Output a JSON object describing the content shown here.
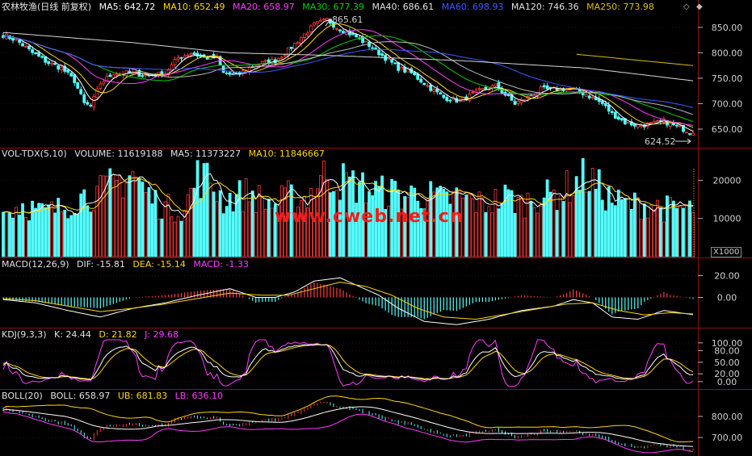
{
  "colors": {
    "up": "#ff3b3b",
    "down": "#54ffff",
    "ma5": "#ffffff",
    "ma10": "#ffd700",
    "ma20": "#ff3cff",
    "ma30": "#00d000",
    "ma60": "#3c5aff",
    "ma120": "#d8d8d8",
    "ma250": "#d8c000",
    "label": "#cccccc",
    "grid": "#8a1010"
  },
  "header": {
    "title": "农林牧渔(日线 前复权)",
    "ma5": "MA5: 642.72",
    "ma10": "MA10: 652.49",
    "ma20": "MA20: 658.97",
    "ma30": "MA30: 677.39",
    "ma40": "MA40: 686.61",
    "ma60": "MA60: 698.93",
    "ma120": "MA120: 746.36",
    "ma250": "MA250: 773.98"
  },
  "vol_header": {
    "name": "VOL-TDX(5,10)",
    "volume": "VOLUME: 11619188",
    "ma5": "MA5: 11373227",
    "ma10": "MA10: 11846667"
  },
  "macd_header": {
    "name": "MACD(12,26,9)",
    "dif": "DIF: -15.81",
    "dea": "DEA: -15.14",
    "macd": "MACD: -1.33"
  },
  "kdj_header": {
    "name": "KDJ(9,3,3)",
    "k": "K: 24.44",
    "d": "D: 21.82",
    "j": "J: 29.68"
  },
  "boll_header": {
    "name": "BOLL(20)",
    "boll": "BOLL: 658.97",
    "ub": "UB: 681.83",
    "lb": "LB: 636.10"
  },
  "watermark": "www.cweb.net.cn",
  "vol_unit": "X1000",
  "annotations": {
    "high": "865.61",
    "low": "624.52"
  },
  "chart_data": [
    {
      "type": "candlestick",
      "title": "农林牧渔(日线 前复权)",
      "ylim": [
        615,
        880
      ],
      "y_ticks": [
        650,
        700,
        750,
        800,
        850
      ],
      "y_tick_labels": [
        "650.00",
        "700.00",
        "750.00",
        "800.00",
        "850.00"
      ],
      "close_anchors": [
        [
          0,
          835
        ],
        [
          4,
          825
        ],
        [
          9,
          800
        ],
        [
          14,
          780
        ],
        [
          18,
          770
        ],
        [
          22,
          745
        ],
        [
          25,
          700
        ],
        [
          27,
          695
        ],
        [
          30,
          740
        ],
        [
          34,
          760
        ],
        [
          40,
          760
        ],
        [
          45,
          755
        ],
        [
          50,
          760
        ],
        [
          54,
          790
        ],
        [
          58,
          800
        ],
        [
          62,
          790
        ],
        [
          66,
          790
        ],
        [
          68,
          760
        ],
        [
          72,
          755
        ],
        [
          76,
          770
        ],
        [
          80,
          780
        ],
        [
          84,
          785
        ],
        [
          88,
          805
        ],
        [
          92,
          830
        ],
        [
          96,
          855
        ],
        [
          100,
          865
        ],
        [
          103,
          850
        ],
        [
          108,
          835
        ],
        [
          113,
          815
        ],
        [
          118,
          790
        ],
        [
          122,
          770
        ],
        [
          126,
          760
        ],
        [
          132,
          730
        ],
        [
          136,
          712
        ],
        [
          141,
          705
        ],
        [
          147,
          725
        ],
        [
          152,
          735
        ],
        [
          158,
          700
        ],
        [
          162,
          712
        ],
        [
          166,
          728
        ],
        [
          171,
          728
        ],
        [
          175,
          730
        ],
        [
          180,
          718
        ],
        [
          185,
          700
        ],
        [
          188,
          680
        ],
        [
          192,
          663
        ],
        [
          196,
          657
        ],
        [
          200,
          660
        ],
        [
          204,
          665
        ],
        [
          208,
          655
        ],
        [
          212,
          645
        ],
        [
          213,
          642
        ]
      ],
      "ma_series": [
        {
          "name": "MA5",
          "final": 642.72
        },
        {
          "name": "MA10",
          "final": 652.49
        },
        {
          "name": "MA20",
          "final": 658.97
        },
        {
          "name": "MA30",
          "final": 677.39
        },
        {
          "name": "MA40",
          "final": 686.61
        },
        {
          "name": "MA60",
          "final": 698.93
        },
        {
          "name": "MA120",
          "final": 746.36,
          "anchors": [
            [
              0,
              840
            ],
            [
              40,
              820
            ],
            [
              70,
              800
            ],
            [
              100,
              795
            ],
            [
              140,
              785
            ],
            [
              180,
              770
            ],
            [
              213,
              745
            ]
          ]
        },
        {
          "name": "MA250",
          "final": 773.98,
          "anchors": [
            [
              177,
              797
            ],
            [
              213,
              775
            ]
          ]
        }
      ],
      "high_annotation": 865.61,
      "low_annotation": 624.52
    },
    {
      "type": "bar",
      "name": "VOL-TDX(5,10)",
      "ylim": [
        0,
        26000
      ],
      "y_ticks": [
        10000,
        20000
      ],
      "y_tick_labels": [
        "10000",
        "20000"
      ],
      "anchors": [
        [
          0,
          11000
        ],
        [
          6,
          13000
        ],
        [
          12,
          11000
        ],
        [
          18,
          12000
        ],
        [
          24,
          15000
        ],
        [
          30,
          16000
        ],
        [
          36,
          19000
        ],
        [
          40,
          21000
        ],
        [
          44,
          16000
        ],
        [
          48,
          13000
        ],
        [
          52,
          12000
        ],
        [
          56,
          12000
        ],
        [
          60,
          20000
        ],
        [
          64,
          19000
        ],
        [
          68,
          14000
        ],
        [
          72,
          15000
        ],
        [
          76,
          16000
        ],
        [
          80,
          14000
        ],
        [
          84,
          13000
        ],
        [
          88,
          15000
        ],
        [
          92,
          14000
        ],
        [
          96,
          17000
        ],
        [
          100,
          21000
        ],
        [
          104,
          19000
        ],
        [
          108,
          18000
        ],
        [
          112,
          17000
        ],
        [
          116,
          16000
        ],
        [
          120,
          16000
        ],
        [
          124,
          15000
        ],
        [
          128,
          16000
        ],
        [
          132,
          15000
        ],
        [
          136,
          14000
        ],
        [
          140,
          15000
        ],
        [
          144,
          14000
        ],
        [
          148,
          13000
        ],
        [
          152,
          14000
        ],
        [
          156,
          15000
        ],
        [
          160,
          13000
        ],
        [
          164,
          15000
        ],
        [
          168,
          15000
        ],
        [
          172,
          16000
        ],
        [
          176,
          18000
        ],
        [
          180,
          20000
        ],
        [
          184,
          17000
        ],
        [
          188,
          14000
        ],
        [
          192,
          13000
        ],
        [
          196,
          13000
        ],
        [
          200,
          13000
        ],
        [
          204,
          12000
        ],
        [
          208,
          12000
        ],
        [
          213,
          11619
        ]
      ],
      "final_volume": 11619188,
      "ma5": 11373227,
      "ma10": 11846667
    },
    {
      "type": "bar",
      "name": "MACD(12,26,9)",
      "ylim": [
        -27,
        27
      ],
      "y_ticks": [
        0,
        20
      ],
      "y_tick_labels": [
        "0.00",
        "20.00"
      ],
      "dif_anchors": [
        [
          0,
          -2
        ],
        [
          10,
          -5
        ],
        [
          20,
          -12
        ],
        [
          30,
          -18
        ],
        [
          40,
          -10
        ],
        [
          50,
          -5
        ],
        [
          60,
          2
        ],
        [
          70,
          8
        ],
        [
          78,
          0
        ],
        [
          84,
          0
        ],
        [
          90,
          5
        ],
        [
          96,
          15
        ],
        [
          104,
          18
        ],
        [
          110,
          10
        ],
        [
          116,
          2
        ],
        [
          122,
          -10
        ],
        [
          130,
          -22
        ],
        [
          140,
          -25
        ],
        [
          150,
          -20
        ],
        [
          160,
          -12
        ],
        [
          170,
          -8
        ],
        [
          176,
          -2
        ],
        [
          182,
          -5
        ],
        [
          188,
          -18
        ],
        [
          196,
          -20
        ],
        [
          204,
          -12
        ],
        [
          213,
          -15.81
        ]
      ],
      "dea_anchors": [
        [
          0,
          -1
        ],
        [
          10,
          -3
        ],
        [
          20,
          -8
        ],
        [
          30,
          -13
        ],
        [
          40,
          -10
        ],
        [
          50,
          -6
        ],
        [
          60,
          -1
        ],
        [
          70,
          4
        ],
        [
          80,
          2
        ],
        [
          88,
          2
        ],
        [
          96,
          8
        ],
        [
          104,
          14
        ],
        [
          112,
          10
        ],
        [
          120,
          2
        ],
        [
          128,
          -10
        ],
        [
          136,
          -18
        ],
        [
          146,
          -20
        ],
        [
          156,
          -15
        ],
        [
          166,
          -10
        ],
        [
          174,
          -6
        ],
        [
          182,
          -5
        ],
        [
          190,
          -12
        ],
        [
          198,
          -16
        ],
        [
          206,
          -14
        ],
        [
          213,
          -15.14
        ]
      ],
      "final": {
        "dif": -15.81,
        "dea": -15.14,
        "macd": -1.33
      }
    },
    {
      "type": "line",
      "name": "KDJ(9,3,3)",
      "ylim": [
        -15,
        110
      ],
      "y_ticks": [
        0,
        20,
        50,
        80,
        100
      ],
      "y_tick_labels": [
        "0.00",
        "20.00",
        "50.00",
        "80.00",
        "100.00"
      ],
      "final": {
        "k": 24.44,
        "d": 21.82,
        "j": 29.68
      }
    },
    {
      "type": "line",
      "name": "BOLL(20)",
      "ylim": [
        620,
        880
      ],
      "y_ticks": [
        700,
        800
      ],
      "y_tick_labels": [
        "700.00",
        "800.00"
      ],
      "final": {
        "boll": 658.97,
        "ub": 681.83,
        "lb": 636.1
      }
    }
  ]
}
